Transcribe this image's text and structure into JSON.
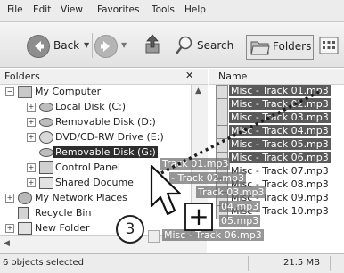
{
  "menu": [
    "File",
    "Edit",
    "View",
    "Favorites",
    "Tools",
    "Help"
  ],
  "toolbar": {
    "back_label": "Back",
    "search_label": "Search",
    "folders_label": "Folders"
  },
  "folders_pane": {
    "title": "Folders",
    "close_glyph": "✕"
  },
  "tree": [
    {
      "label": "My Computer",
      "icon": "computer-icon",
      "toggle": "−"
    },
    {
      "label": "Local Disk (C:)",
      "icon": "drive-icon",
      "toggle": "+"
    },
    {
      "label": "Removable Disk (D:)",
      "icon": "drive-icon",
      "toggle": "+"
    },
    {
      "label": "DVD/CD-RW Drive (E:)",
      "icon": "dvd-icon",
      "toggle": "+"
    },
    {
      "label": "Removable Disk (G:)",
      "icon": "drive-icon",
      "toggle": "",
      "selected": true
    },
    {
      "label": "Control Panel",
      "icon": "control-panel-icon",
      "toggle": "+"
    },
    {
      "label": "Shared Docume",
      "icon": "folder-icon",
      "toggle": "+"
    },
    {
      "label": "My Network Places",
      "icon": "network-icon",
      "toggle": "+"
    },
    {
      "label": "Recycle Bin",
      "icon": "recycle-bin-icon",
      "toggle": ""
    },
    {
      "label": "New Folder",
      "icon": "folder-icon",
      "toggle": "+"
    }
  ],
  "files_pane": {
    "column_name": "Name"
  },
  "files": [
    {
      "name": "Misc - Track 01.mp3",
      "selected": true
    },
    {
      "name": "Misc - Track 02.mp3",
      "selected": true
    },
    {
      "name": "Misc - Track 03.mp3",
      "selected": true
    },
    {
      "name": "Misc - Track 04.mp3",
      "selected": true
    },
    {
      "name": "Misc - Track 05.mp3",
      "selected": true
    },
    {
      "name": "Misc - Track 06.mp3",
      "selected": true
    },
    {
      "name": "Misc - Track 07.mp3",
      "selected": false
    },
    {
      "name": "Misc - Track 08.mp3",
      "selected": false
    },
    {
      "name": "Misc - Track 09.mp3",
      "selected": false
    },
    {
      "name": "Misc - Track 10.mp3",
      "selected": false
    }
  ],
  "drag_ghost": [
    "Track 01.mp3",
    "- Track 02.mp3",
    "Track 03.mp3",
    "04.mp3",
    "05.mp3",
    "Misc - Track 06.mp3"
  ],
  "status": {
    "selection": "6 objects selected",
    "size": "21.5 MB"
  },
  "annotation": {
    "step_number": "3",
    "copy_glyph": "+"
  }
}
